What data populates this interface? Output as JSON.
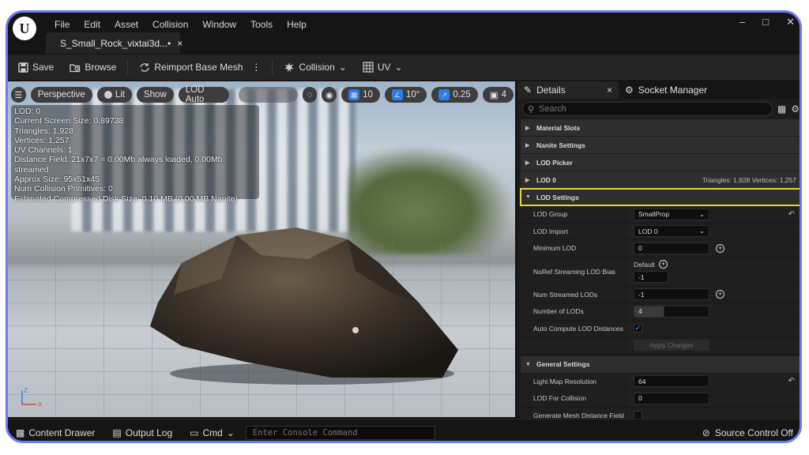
{
  "app": {
    "logo_glyph": "U"
  },
  "menu": [
    "File",
    "Edit",
    "Asset",
    "Collision",
    "Window",
    "Tools",
    "Help"
  ],
  "asset_tab": {
    "label": "S_Small_Rock_vixtai3d...•",
    "close": "×"
  },
  "window_controls": {
    "minimize": "–",
    "maximize": "□",
    "close": "✕"
  },
  "toolbar": {
    "save": "Save",
    "browse": "Browse",
    "reimport": "Reimport Base Mesh",
    "collision": "Collision",
    "uv": "UV"
  },
  "viewport_bar": {
    "perspective": "Perspective",
    "lit": "Lit",
    "show": "Show",
    "lod": "LOD Auto",
    "grid_snap": "10",
    "rotation_snap": "10°",
    "scale_snap": "0.25",
    "camera_speed": "4"
  },
  "stats": [
    "LOD: 0",
    "Current Screen Size: 0.89738",
    "Triangles: 1,928",
    "Vertices: 1,257",
    "UV Channels: 1",
    "Distance Field: 21x7x7 = 0.00Mb always loaded, 0.00Mb streamed",
    "Approx Size: 95x51x45",
    "Num Collision Primitives: 0",
    "Estimated Compressed Disk Size: 0.10 MB (0.00 MB Nanite)"
  ],
  "axis": {
    "z": "Z",
    "x": "X"
  },
  "details": {
    "tab_details": "Details",
    "tab_close": "×",
    "tab_socket": "Socket Manager",
    "search_placeholder": "Search",
    "sections": {
      "material_slots": "Material Slots",
      "nanite": "Nanite Settings",
      "lod_picker": "LOD Picker",
      "lod0": "LOD 0",
      "lod0_info": "Triangles: 1,928   Vertices: 1,257",
      "lod_settings": "LOD Settings",
      "general": "General Settings"
    },
    "props": {
      "lod_group_label": "LOD Group",
      "lod_group_value": "SmallProp",
      "lod_import_label": "LOD Import",
      "lod_import_value": "LOD 0",
      "min_lod_label": "Minimum LOD",
      "min_lod_value": "0",
      "noref_label": "NoRef Streaming LOD Bias",
      "noref_default": "Default",
      "noref_value": "-1",
      "num_streamed_label": "Num Streamed LODs",
      "num_streamed_value": "-1",
      "num_lods_label": "Number of LODs",
      "num_lods_value": "4",
      "auto_compute_label": "Auto Compute LOD Distances",
      "apply_changes": "Apply Changes",
      "lightmap_label": "Light Map Resolution",
      "lightmap_value": "64",
      "lod_collision_label": "LOD For Collision",
      "lod_collision_value": "0",
      "gen_distance_label": "Generate Mesh Distance Field"
    }
  },
  "statusbar": {
    "content_drawer": "Content Drawer",
    "output_log": "Output Log",
    "cmd": "Cmd",
    "console_placeholder": "Enter Console Command",
    "source_control": "Source Control Off"
  },
  "colors": {
    "accent": "#2b7de9",
    "highlight": "#e5d73a",
    "frame": "#6b7cf0"
  }
}
